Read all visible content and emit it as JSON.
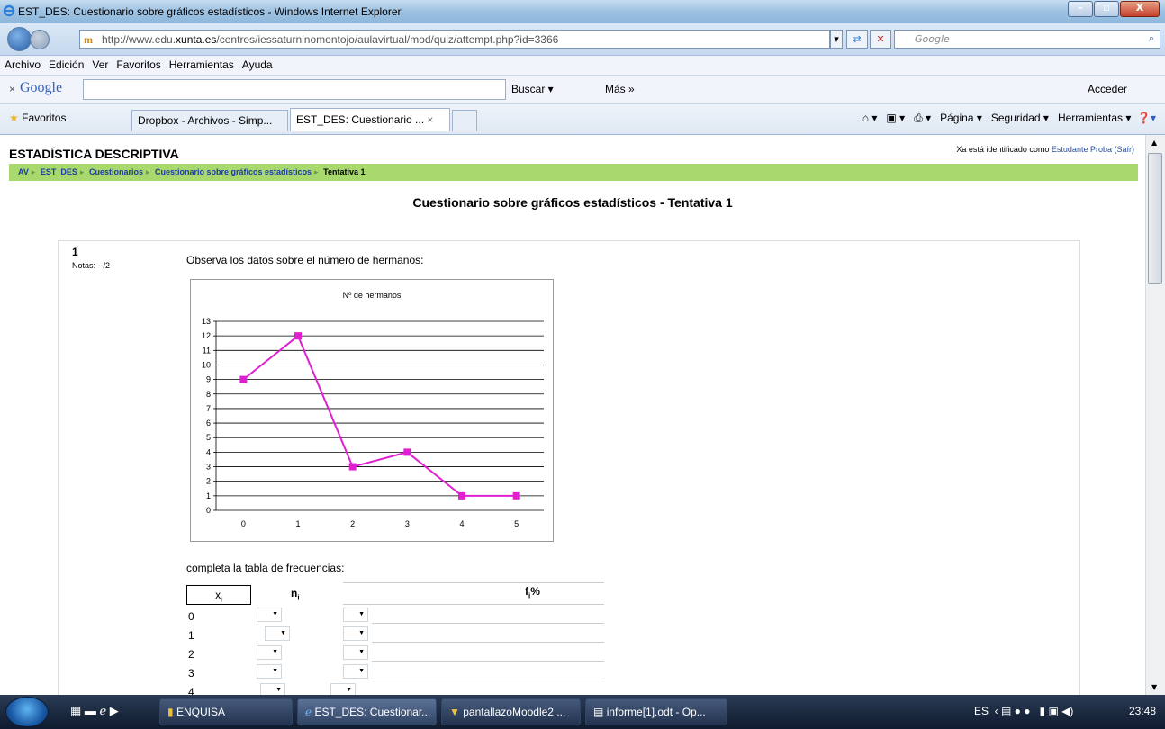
{
  "window": {
    "title": "EST_DES: Cuestionario sobre gráficos estadísticos - Windows Internet Explorer",
    "minimize": "–",
    "maximize": "▫",
    "close": "X"
  },
  "address": {
    "url_prefix": "http://www.edu.",
    "url_domain": "xunta.es",
    "url_rest": "/centros/iessaturninomontojo/aulavirtual/mod/quiz/attempt.php?id=3366",
    "search_placeholder": "Google"
  },
  "menu": [
    "Archivo",
    "Edición",
    "Ver",
    "Favoritos",
    "Herramientas",
    "Ayuda"
  ],
  "google_toolbar": {
    "close": "×",
    "logo": "Google",
    "buscar": "Buscar ▾",
    "mas": "Más »",
    "acceder": "Acceder"
  },
  "favorites": {
    "label": "Favoritos",
    "tab1": "Dropbox - Archivos - Simp...",
    "tab2": "EST_DES: Cuestionario ...",
    "tab2_close": "×",
    "commands": [
      "Página ▾",
      "Seguridad ▾",
      "Herramientas ▾"
    ]
  },
  "page": {
    "course_title": "ESTADÍSTICA DESCRIPTIVA",
    "logged_text": "Xa está identificado como",
    "logged_user": "Estudante Proba",
    "logged_exit": "(Saír)",
    "breadcrumb": [
      "AV",
      "EST_DES",
      "Cuestionarios",
      "Cuestionario sobre gráficos estadísticos",
      "Tentativa 1"
    ],
    "quiz_title": "Cuestionario sobre gráficos estadísticos - Tentativa 1",
    "question_number": "1",
    "notas": "Notas: --/2",
    "question_text": "Observa los datos sobre el número de hermanos:",
    "complete_text": "completa la tabla de frecuencias:",
    "table_headers": {
      "x": "x",
      "x_sub": "i",
      "n": "n",
      "n_sub": "i",
      "f": "f",
      "f_sub": "i",
      "f_pct": "%"
    },
    "rows": [
      "0",
      "1",
      "2",
      "3",
      "4"
    ]
  },
  "chart_data": {
    "type": "line",
    "title": "Nº de hermanos",
    "x": [
      "0",
      "1",
      "2",
      "3",
      "4",
      "5"
    ],
    "values": [
      9,
      12,
      3,
      4,
      1,
      1
    ],
    "yticks": [
      0,
      1,
      2,
      3,
      4,
      5,
      6,
      7,
      8,
      9,
      10,
      11,
      12,
      13
    ],
    "ylim": [
      0,
      13
    ],
    "grid": true,
    "color": "#e020d0"
  },
  "taskbar": {
    "items": [
      "ENQUISA",
      "EST_DES: Cuestionar...",
      "pantallazoMoodle2 ...",
      "informe[1].odt - Op..."
    ],
    "lang": "ES",
    "clock": "23:48"
  }
}
